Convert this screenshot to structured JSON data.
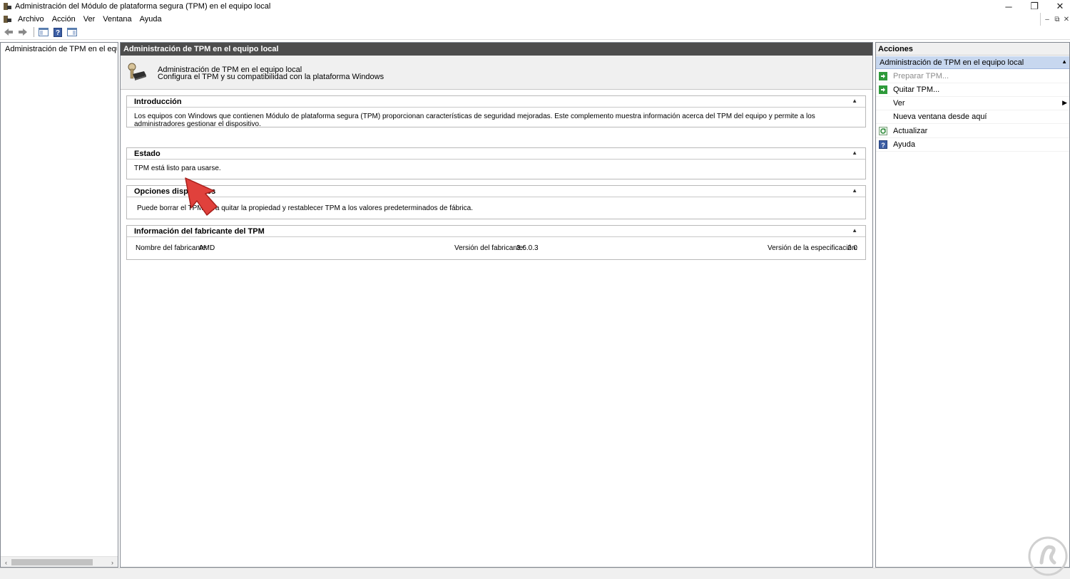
{
  "window": {
    "title": "Administración del Módulo de plataforma segura (TPM) en el equipo local",
    "minimize_icon": "minimize-icon",
    "restore_icon": "restore-icon",
    "close_icon": "close-icon"
  },
  "menu": {
    "items": [
      "Archivo",
      "Acción",
      "Ver",
      "Ventana",
      "Ayuda"
    ]
  },
  "toolbar": {
    "icons": [
      "back-arrow-icon",
      "forward-arrow-icon",
      "show-hide-console-tree-icon",
      "help-icon",
      "show-hide-action-pane-icon"
    ]
  },
  "tree": {
    "root_label": "Administración de TPM en el equipo local"
  },
  "center": {
    "header": "Administración de TPM en el equipo local",
    "banner_line1": "Administración de TPM en el equipo local",
    "banner_line2": "Configura el TPM y su compatibilidad con la plataforma Windows",
    "sections": {
      "intro": {
        "title": "Introducción",
        "text": "Los equipos con Windows que contienen Módulo de plataforma segura (TPM) proporcionan características de seguridad mejoradas. Este complemento muestra información acerca del TPM del equipo y permite a los administradores gestionar el dispositivo."
      },
      "status": {
        "title": "Estado",
        "text": "TPM está listo para usarse."
      },
      "options": {
        "title": "Opciones disponibles",
        "text": "Puede borrar el TPM para quitar la propiedad y restablecer TPM a los valores predeterminados de fábrica."
      },
      "manufacturer": {
        "title": "Información del fabricante del TPM",
        "name_label": "Nombre del fabricante:",
        "name_value": "AMD",
        "version_label": "Versión del fabricante:",
        "version_value": "3.6.0.3",
        "spec_label": "Versión de la especificación:",
        "spec_value": "2.0"
      }
    }
  },
  "actions": {
    "header": "Acciones",
    "group": "Administración de TPM en el equipo local",
    "items": [
      {
        "label": "Preparar TPM...",
        "icon": "green-arrow-icon",
        "enabled": false
      },
      {
        "label": "Quitar TPM...",
        "icon": "green-arrow-icon",
        "enabled": true
      },
      {
        "label": "Ver",
        "icon": "",
        "enabled": true
      },
      {
        "label": "Nueva ventana desde aquí",
        "icon": "",
        "enabled": true
      },
      {
        "label": "Actualizar",
        "icon": "refresh-icon",
        "enabled": true
      },
      {
        "label": "Ayuda",
        "icon": "help-icon",
        "enabled": true
      }
    ]
  },
  "colors": {
    "center_header_bg": "#4d4d4d",
    "actions_group_bg": "#c7d7ef",
    "annotation_arrow": "#e0413c"
  }
}
